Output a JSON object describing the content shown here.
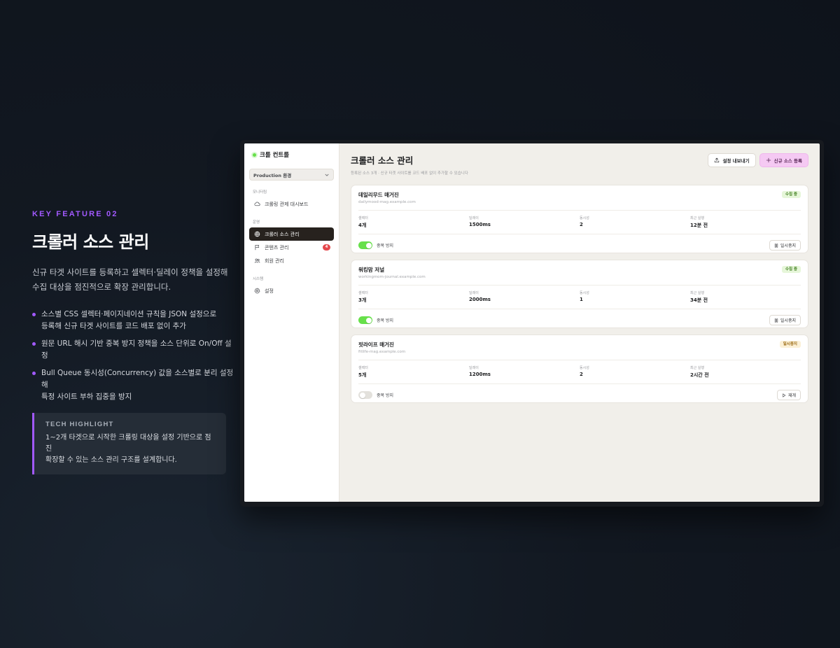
{
  "feature": {
    "kicker": "KEY FEATURE 02",
    "title": "크롤러 소스 관리",
    "description_line1": "신규 타겟 사이트를 등록하고 셀렉터·딜레이 정책을 설정해",
    "description_line2": "수집 대상을 점진적으로 확장 관리합니다.",
    "bullets": [
      {
        "line1": "소스별 CSS 셀렉터·페이지네이션 규칙을 JSON 설정으로",
        "line2": "등록해 신규 타겟 사이트를 코드 배포 없이 추가"
      },
      {
        "line1": "원문 URL 해시 기반 중복 방지 정책을 소스 단위로 On/Off 설정",
        "line2": ""
      },
      {
        "line1": "Bull Queue 동시성(Concurrency) 값을 소스별로 분리 설정해",
        "line2": "특정 사이트 부하 집중을 방지"
      }
    ],
    "highlight": {
      "title": "TECH HIGHLIGHT",
      "line1": "1~2개 타겟으로 시작한 크롤링 대상을 설정 기반으로 점진",
      "line2": "확장할 수 있는 소스 관리 구조를 설계합니다."
    }
  },
  "app": {
    "brand": "크롤 컨트롤",
    "environment": "Production 환경",
    "sections": {
      "monitoring": "모니터링",
      "operations": "운영",
      "system": "시스템"
    },
    "nav": {
      "dashboard": "크롤링 관제 대시보드",
      "sources": "크롤러 소스 관리",
      "contents": "콘텐츠 관리",
      "contents_badge": "4",
      "members": "회원 관리",
      "settings": "설정"
    },
    "page_title": "크롤러 소스 관리",
    "page_subtitle": "등록된 소스 3개 · 신규 타겟 사이트를 코드 배포 없이 추가할 수 있습니다",
    "export_label": "설정 내보내기",
    "add_label": "신규 소스 등록",
    "stat_labels": {
      "selectors": "셀렉터",
      "delay": "딜레이",
      "concurrency": "동시성",
      "last_run": "최근 실행"
    },
    "dedupe_label": "중복 방지",
    "sources": [
      {
        "name": "데일리무드 매거진",
        "domain": "dailymood-mag.example.com",
        "status": "수집 중",
        "selectors": "4개",
        "delay": "1500ms",
        "concurrency": "2",
        "last_run": "12분 전",
        "action": "일시중지"
      },
      {
        "name": "워킹맘 저널",
        "domain": "workingmom-journal.example.com",
        "status": "수집 중",
        "selectors": "3개",
        "delay": "2000ms",
        "concurrency": "1",
        "last_run": "34분 전",
        "action": "일시중지"
      },
      {
        "name": "핏라이프 매거진",
        "domain": "fitlife-mag.example.com",
        "status": "일시중지",
        "selectors": "5개",
        "delay": "1200ms",
        "concurrency": "2",
        "last_run": "2시간 전",
        "action": "재개"
      }
    ],
    "colors": {
      "accent": "#a259ff",
      "toggle_on": "#67e04a",
      "primary_button": "#f5c9f3",
      "active_nav": "#27221e"
    }
  }
}
